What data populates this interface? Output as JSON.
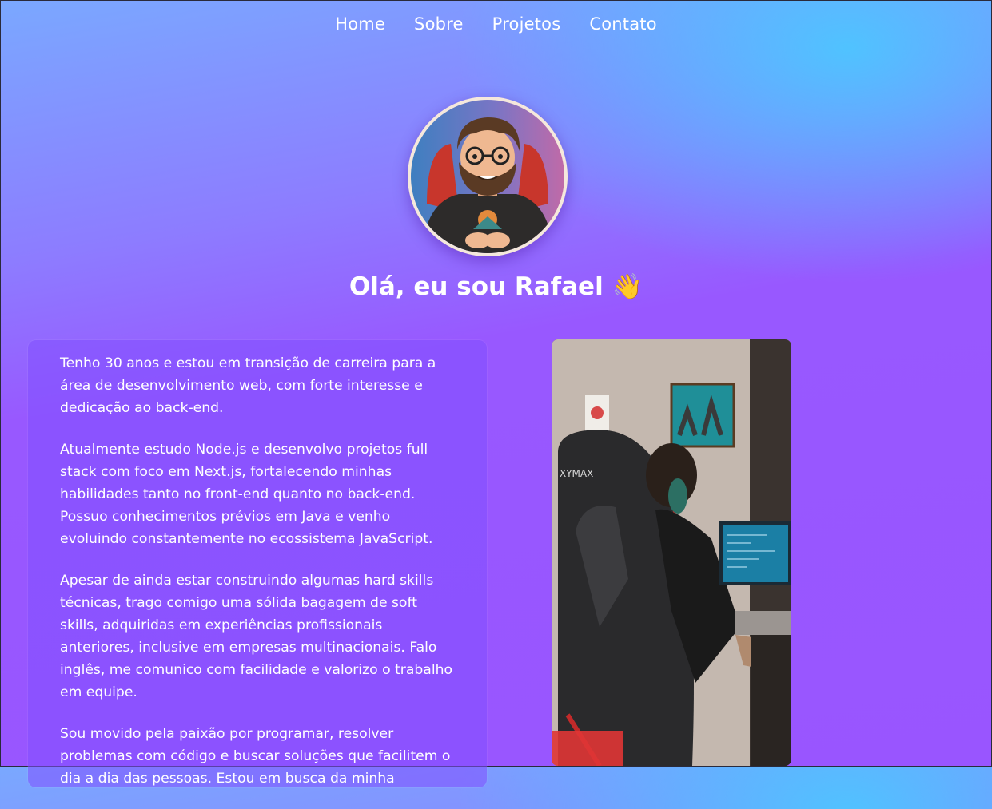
{
  "nav": {
    "items": [
      {
        "label": "Home"
      },
      {
        "label": "Sobre"
      },
      {
        "label": "Projetos"
      },
      {
        "label": "Contato"
      }
    ]
  },
  "hero": {
    "greeting": "Olá, eu sou Rafael 👋",
    "avatar_icon": "cartoon-avatar"
  },
  "about": {
    "paragraphs": [
      "Tenho 30 anos e estou em transição de carreira para a área de desenvolvimento web, com forte interesse e dedicação ao back-end.",
      "Atualmente estudo Node.js e desenvolvo projetos full stack com foco em Next.js, fortalecendo minhas habilidades tanto no front-end quanto no back-end. Possuo conhecimentos prévios em Java e venho evoluindo constantemente no ecossistema JavaScript.",
      "Apesar de ainda estar construindo algumas hard skills técnicas, trago comigo uma sólida bagagem de soft skills, adquiridas em experiências profissionais anteriores, inclusive em empresas multinacionais. Falo inglês, me comunico com facilidade e valorizo o trabalho em equipe.",
      "Sou movido pela paixão por programar, resolver problemas com código e buscar soluções que facilitem o dia a dia das pessoas. Estou em busca da minha"
    ]
  },
  "photo": {
    "chair_brand": "XYMAX"
  },
  "colors": {
    "gradient_top_right": "#46cdff",
    "gradient_main": "#9955ff",
    "card_bg": "#8250ff",
    "text": "#ffffff"
  }
}
